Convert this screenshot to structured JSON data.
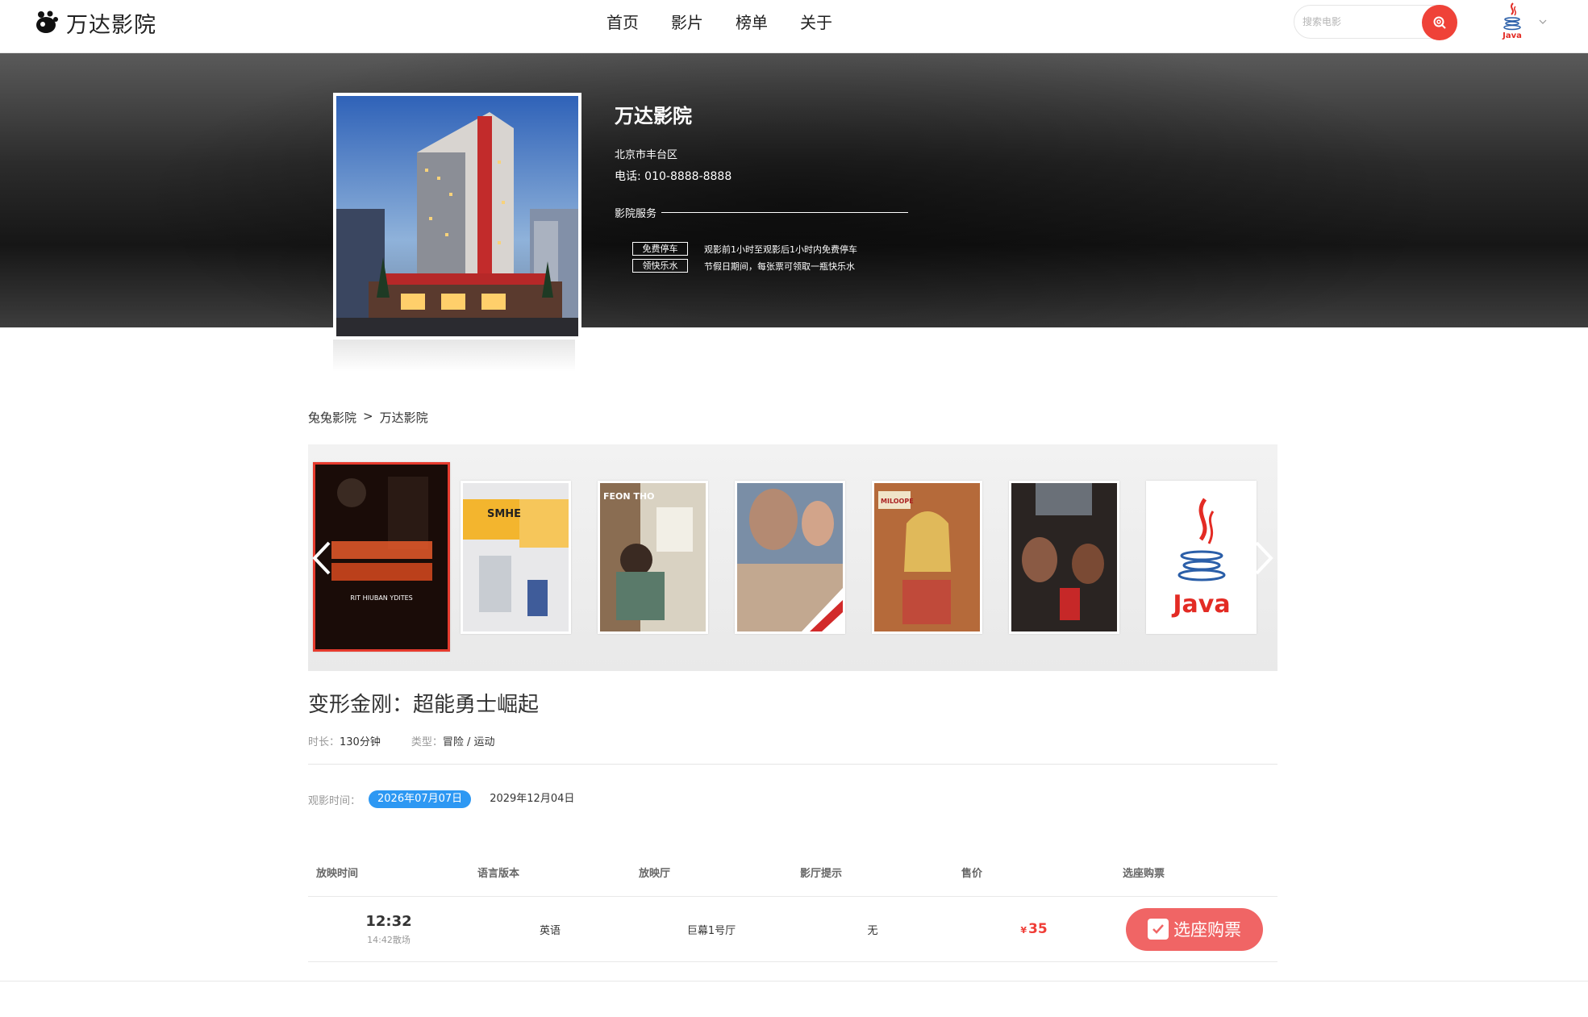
{
  "header": {
    "brand": "万达影院",
    "nav": [
      "首页",
      "影片",
      "榜单",
      "关于"
    ],
    "search_placeholder": "搜索电影",
    "user_avatar_text": "Java"
  },
  "cinema": {
    "name": "万达影院",
    "address": "北京市丰台区",
    "phone": "电话: 010-8888-8888",
    "service_title": "影院服务",
    "services": [
      {
        "tag": "免费停车",
        "desc": "观影前1小时至观影后1小时内免费停车"
      },
      {
        "tag": "领快乐水",
        "desc": "节假日期间，每张票可领取一瓶快乐水"
      }
    ]
  },
  "breadcrumb": {
    "root": "兔兔影院",
    "separator": ">",
    "current": "万达影院"
  },
  "posters": [
    {
      "text": "RIT HIUBAN YDITES"
    },
    {
      "text": "SMHE"
    },
    {
      "text": "FEON THO"
    },
    {
      "text": ""
    },
    {
      "text": "MILOOPE"
    },
    {
      "text": ""
    },
    {
      "text": "Java"
    }
  ],
  "movie": {
    "title": "变形金刚：超能勇士崛起",
    "duration_label": "时长：",
    "duration": "130分钟",
    "genre_label": "类型：",
    "genre": "冒险 / 运动"
  },
  "watch_time": {
    "label": "观影时间：",
    "dates": [
      "2026年07月07日",
      "2029年12月04日"
    ],
    "selected_index": 0
  },
  "table": {
    "headers": [
      "放映时间",
      "语言版本",
      "放映厅",
      "影厅提示",
      "售价",
      "选座购票"
    ],
    "rows": [
      {
        "time": "12:32",
        "end": "14:42散场",
        "language": "英语",
        "hall": "巨幕1号厅",
        "tip": "无",
        "currency": "¥",
        "price": "35",
        "button": "选座购票"
      }
    ]
  },
  "colors": {
    "accent": "#ef4238",
    "selected_date": "#2d98f3",
    "buy_button": "#f06565",
    "poster_active_border": "#e63b2e"
  }
}
